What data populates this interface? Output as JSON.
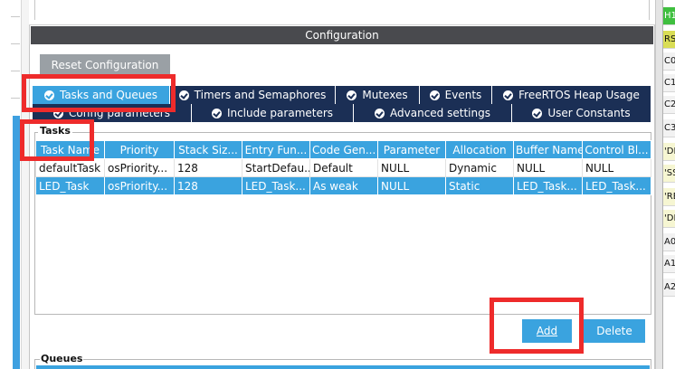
{
  "config": {
    "header": "Configuration",
    "reset_label": "Reset Configuration"
  },
  "tabs_row1": [
    {
      "label": "Tasks and Queues",
      "active": true
    },
    {
      "label": "Timers and Semaphores",
      "active": false
    },
    {
      "label": "Mutexes",
      "active": false
    },
    {
      "label": "Events",
      "active": false
    },
    {
      "label": "FreeRTOS Heap Usage",
      "active": false
    }
  ],
  "tabs_row2": [
    {
      "label": "Config parameters"
    },
    {
      "label": "Include parameters"
    },
    {
      "label": "Advanced settings"
    },
    {
      "label": "User Constants"
    }
  ],
  "tasks": {
    "legend": "Tasks",
    "columns": [
      "Task Name",
      "Priority",
      "Stack Siz...",
      "Entry Fun...",
      "Code Gen...",
      "Parameter",
      "Allocation",
      "Buffer Name",
      "Control Bl..."
    ],
    "rows": [
      [
        "defaultTask",
        "osPriority...",
        "128",
        "StartDefau...",
        "Default",
        "NULL",
        "Dynamic",
        "NULL",
        "NULL"
      ],
      [
        "LED_Task",
        "osPriority...",
        "128",
        "LED_Task...",
        "As weak",
        "NULL",
        "Static",
        "LED_Task...",
        "LED_Task..."
      ]
    ],
    "selected_row": 1
  },
  "buttons": {
    "add_label": "Add",
    "delete_label": "Delete"
  },
  "queues": {
    "legend": "Queues"
  },
  "right_pins": [
    {
      "label": "H1",
      "style": "green"
    },
    {
      "label": "RS",
      "style": "yellow"
    },
    {
      "label": "C0",
      "style": "gray"
    },
    {
      "label": "C1",
      "style": "gray"
    },
    {
      "label": "C2",
      "style": "gray"
    },
    {
      "label": "C3",
      "style": "gray"
    },
    {
      "label": "'DD",
      "style": "pale"
    },
    {
      "label": "'SS",
      "style": "pale"
    },
    {
      "label": "'RE",
      "style": "pale"
    },
    {
      "label": "'DD",
      "style": "pale"
    },
    {
      "label": "A0",
      "style": "gray"
    },
    {
      "label": "A1",
      "style": "gray"
    },
    {
      "label": "A2",
      "style": "gray"
    }
  ],
  "colors": {
    "tab_active": "#3aa3df",
    "tab_inactive": "#1b2f55",
    "header_bg": "#494a4e",
    "annotation_red": "#ee2b2b"
  }
}
